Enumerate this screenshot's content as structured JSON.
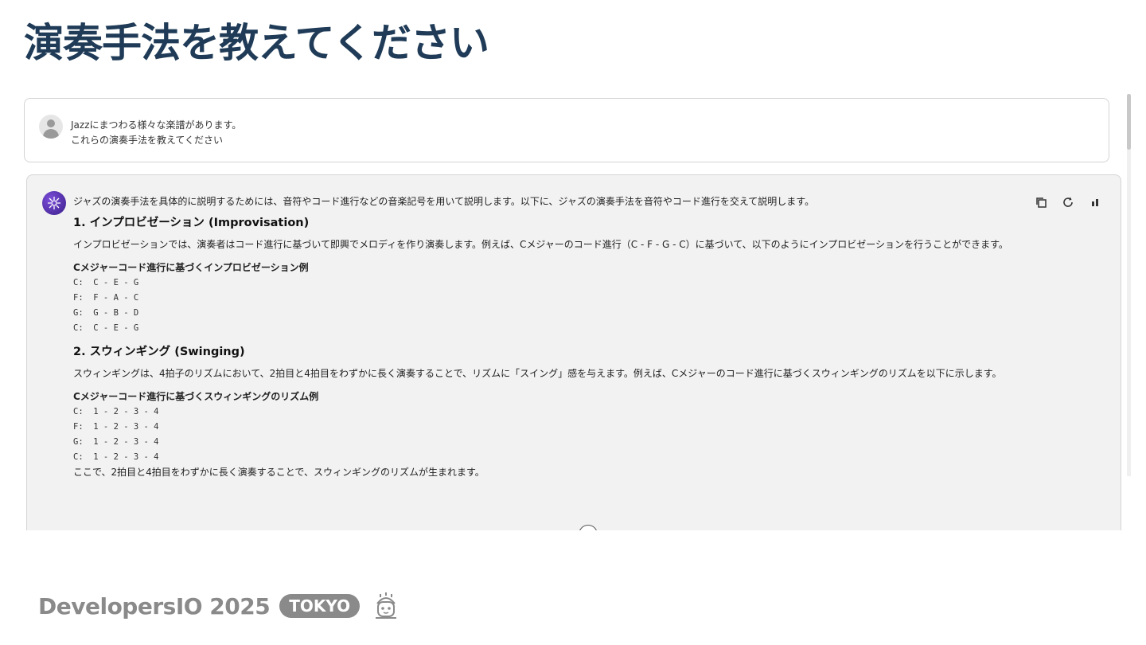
{
  "slide": {
    "title": "演奏手法を教えてください"
  },
  "user_message": {
    "lines": [
      "Jazzにまつわる様々な楽譜があります。",
      "これらの演奏手法を教えてください"
    ]
  },
  "assistant_message": {
    "intro": "ジャズの演奏手法を具体的に説明するためには、音符やコード進行などの音楽記号を用いて説明します。以下に、ジャズの演奏手法を音符やコード進行を交えて説明します。",
    "sections": [
      {
        "heading": "1. インプロビゼーション (Improvisation)",
        "paragraph": "インプロビゼーションでは、演奏者はコード進行に基づいて即興でメロディを作り演奏します。例えば、Cメジャーのコード進行（C - F - G - C）に基づいて、以下のようにインプロビゼーションを行うことができます。",
        "example_title": "Cメジャーコード進行に基づくインプロビゼーション例",
        "example_lines": [
          "C:  C - E - G",
          "F:  F - A - C",
          "G:  G - B - D",
          "C:  C - E - G"
        ]
      },
      {
        "heading": "2. スウィンギング (Swinging)",
        "paragraph": "スウィンギングは、4拍子のリズムにおいて、2拍目と4拍目をわずかに長く演奏することで、リズムに「スイング」感を与えます。例えば、Cメジャーのコード進行に基づくスウィンギングのリズムを以下に示します。",
        "example_title": "Cメジャーコード進行に基づくスウィンギングのリズム例",
        "example_lines": [
          "C:  1 - 2 - 3 - 4",
          "F:  1 - 2 - 3 - 4",
          "G:  1 - 2 - 3 - 4",
          "C:  1 - 2 - 3 - 4"
        ]
      }
    ],
    "trailing": "ここで、2拍目と4拍目をわずかに長く演奏することで、スウィンギングのリズムが生まれます。",
    "actions": {
      "copy_icon": "copy-icon",
      "regenerate_icon": "refresh-icon",
      "metrics_icon": "bar-chart-icon"
    }
  },
  "branding": {
    "name": "DevelopersIO 2025",
    "badge": "TOKYO",
    "colors": {
      "title": "#1f3b57",
      "brand_gray": "#8a8a8a",
      "bot_avatar": "#5b2fb8"
    }
  }
}
